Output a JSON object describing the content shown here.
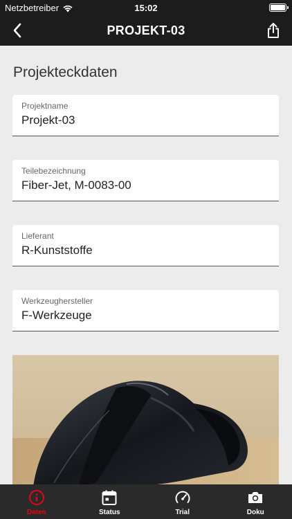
{
  "status_bar": {
    "carrier": "Netzbetreiber",
    "time": "15:02"
  },
  "nav": {
    "title": "PROJEKT-03"
  },
  "section": {
    "title": "Projekteckdaten"
  },
  "fields": [
    {
      "label": "Projektname",
      "value": "Projekt-03"
    },
    {
      "label": "Teilebezeichnung",
      "value": "Fiber-Jet, M-0083-00"
    },
    {
      "label": "Lieferant",
      "value": "R-Kunststoffe"
    },
    {
      "label": "Werkzeughersteller",
      "value": "F-Werkzeuge"
    }
  ],
  "tabs": [
    {
      "label": "Daten",
      "icon": "info-icon",
      "active": true
    },
    {
      "label": "Status",
      "icon": "calendar-icon",
      "active": false
    },
    {
      "label": "Trial",
      "icon": "gauge-icon",
      "active": false
    },
    {
      "label": "Doku",
      "icon": "camera-icon",
      "active": false
    }
  ],
  "colors": {
    "accent": "#e30613",
    "bar": "#1c1c1c",
    "tab_bar": "#2a2a2a",
    "background": "#ececec"
  }
}
